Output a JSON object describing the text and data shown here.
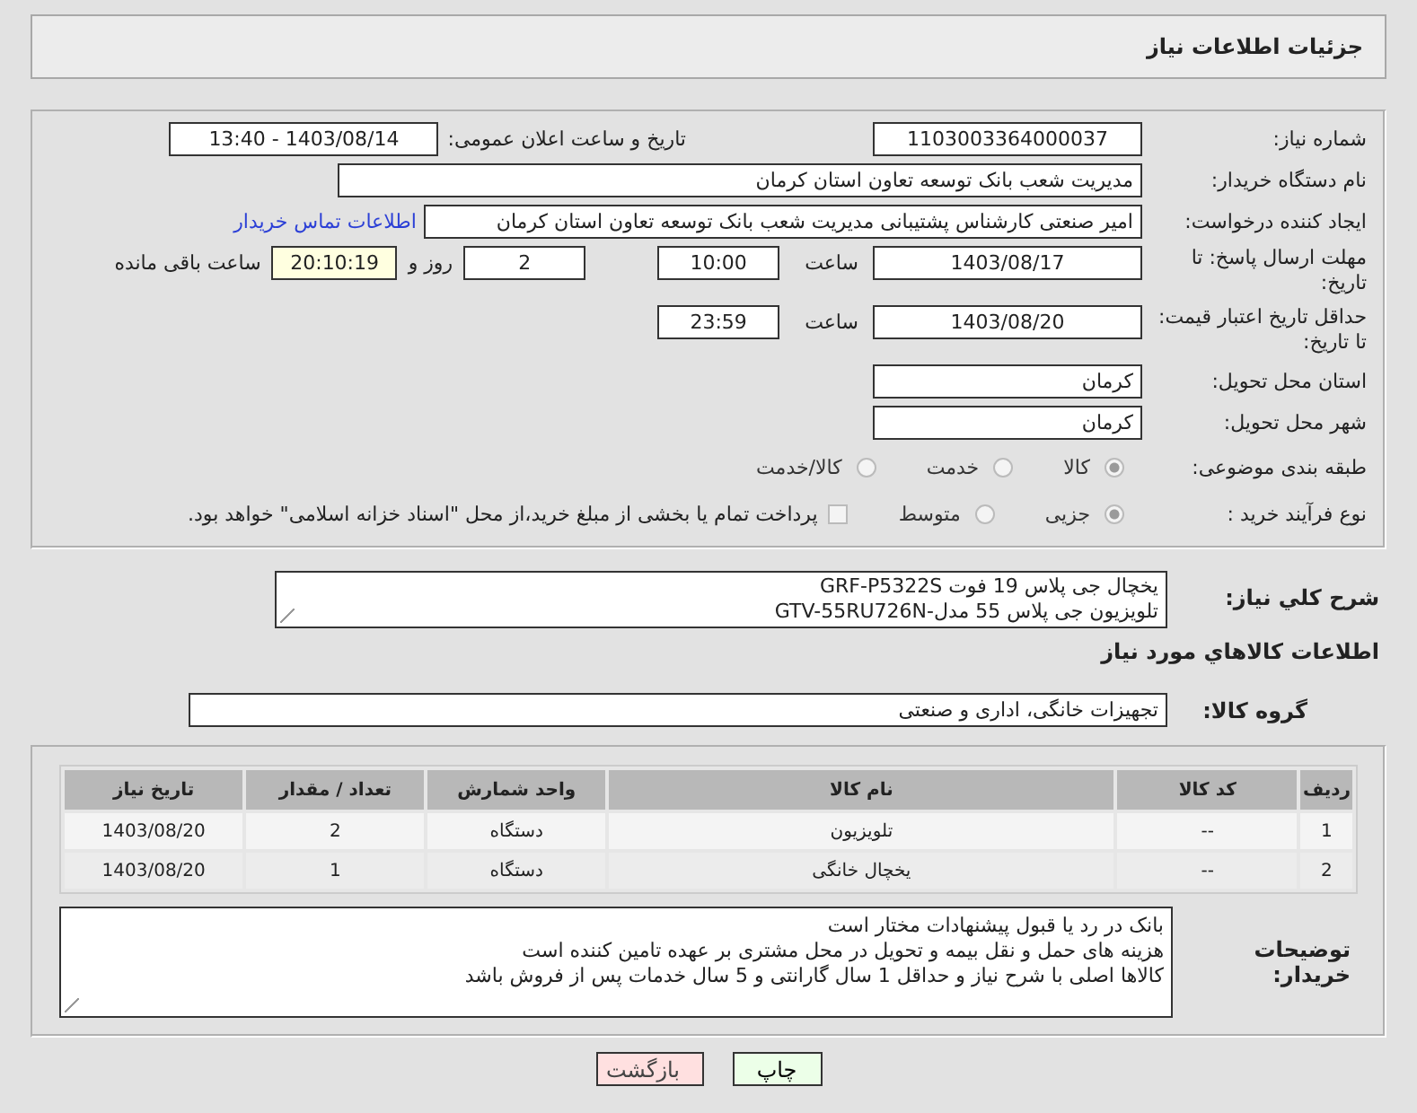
{
  "header": {
    "title": "جزئیات اطلاعات نیاز"
  },
  "need_number": {
    "label": "شماره نیاز:",
    "value": "1103003364000037"
  },
  "announce": {
    "label": "تاریخ و ساعت اعلان عمومی:",
    "value": "1403/08/14 - 13:40"
  },
  "buyer_org": {
    "label": "نام دستگاه خریدار:",
    "value": "مدیریت شعب بانک توسعه تعاون استان کرمان"
  },
  "requester": {
    "label": "ایجاد کننده درخواست:",
    "value": "امیر صنعتی کارشناس پشتیبانی مدیریت شعب بانک توسعه تعاون استان کرمان",
    "link": "اطلاعات تماس خریدار"
  },
  "reply_deadline": {
    "label": "مهلت ارسال پاسخ: تا تاریخ:",
    "date": "1403/08/17",
    "time_label": "ساعت",
    "time": "10:00",
    "days": "2",
    "days_label": "روز و",
    "remaining": "20:10:19",
    "remaining_label": "ساعت باقی مانده"
  },
  "price_validity": {
    "label": "حداقل تاریخ اعتبار قیمت: تا تاریخ:",
    "date": "1403/08/20",
    "time_label": "ساعت",
    "time": "23:59"
  },
  "delivery_province": {
    "label": "استان محل تحویل:",
    "value": "کرمان"
  },
  "delivery_city": {
    "label": "شهر محل تحویل:",
    "value": "کرمان"
  },
  "category": {
    "label": "طبقه بندی موضوعی:",
    "options": [
      {
        "label": "کالا",
        "selected": true
      },
      {
        "label": "خدمت",
        "selected": false
      },
      {
        "label": "کالا/خدمت",
        "selected": false
      }
    ]
  },
  "process": {
    "label": "نوع فرآیند خرید :",
    "options": [
      {
        "label": "جزیی",
        "selected": true
      },
      {
        "label": "متوسط",
        "selected": false
      }
    ],
    "payment_option": {
      "checked": false,
      "text": "پرداخت تمام یا بخشی از مبلغ خرید،از محل \"اسناد خزانه اسلامی\" خواهد بود."
    }
  },
  "summary": {
    "label": "شرح کلي نیاز:",
    "lines": [
      "یخچال جی پلاس 19 فوت GRF-P5322S",
      "تلویزیون جی پلاس 55 مدل-GTV-55RU726N"
    ]
  },
  "goods_heading": "اطلاعات کالاهاي مورد نیاز",
  "goods_group": {
    "label": "گروه کالا:",
    "value": "تجهیزات خانگی، اداری و صنعتی"
  },
  "table": {
    "columns": [
      "ردیف",
      "کد کالا",
      "نام کالا",
      "واحد شمارش",
      "تعداد / مقدار",
      "تاریخ نیاز"
    ],
    "rows": [
      [
        "1",
        "--",
        "تلویزیون",
        "دستگاه",
        "2",
        "1403/08/20"
      ],
      [
        "2",
        "--",
        "یخچال خانگی",
        "دستگاه",
        "1",
        "1403/08/20"
      ]
    ]
  },
  "buyer_notes": {
    "label": "توضیحات خریدار:",
    "lines": [
      "بانک در رد یا قبول پیشنهادات مختار است",
      "هزینه های حمل و نقل بیمه و تحویل در محل مشتری بر عهده تامین کننده است",
      "کالاها اصلی با شرح نیاز و حداقل 1 سال گارانتی و 5 سال خدمات پس از فروش باشد"
    ]
  },
  "buttons": [
    {
      "label": "چاپ",
      "kind": "print"
    },
    {
      "label": "بازگشت",
      "kind": "back"
    }
  ]
}
